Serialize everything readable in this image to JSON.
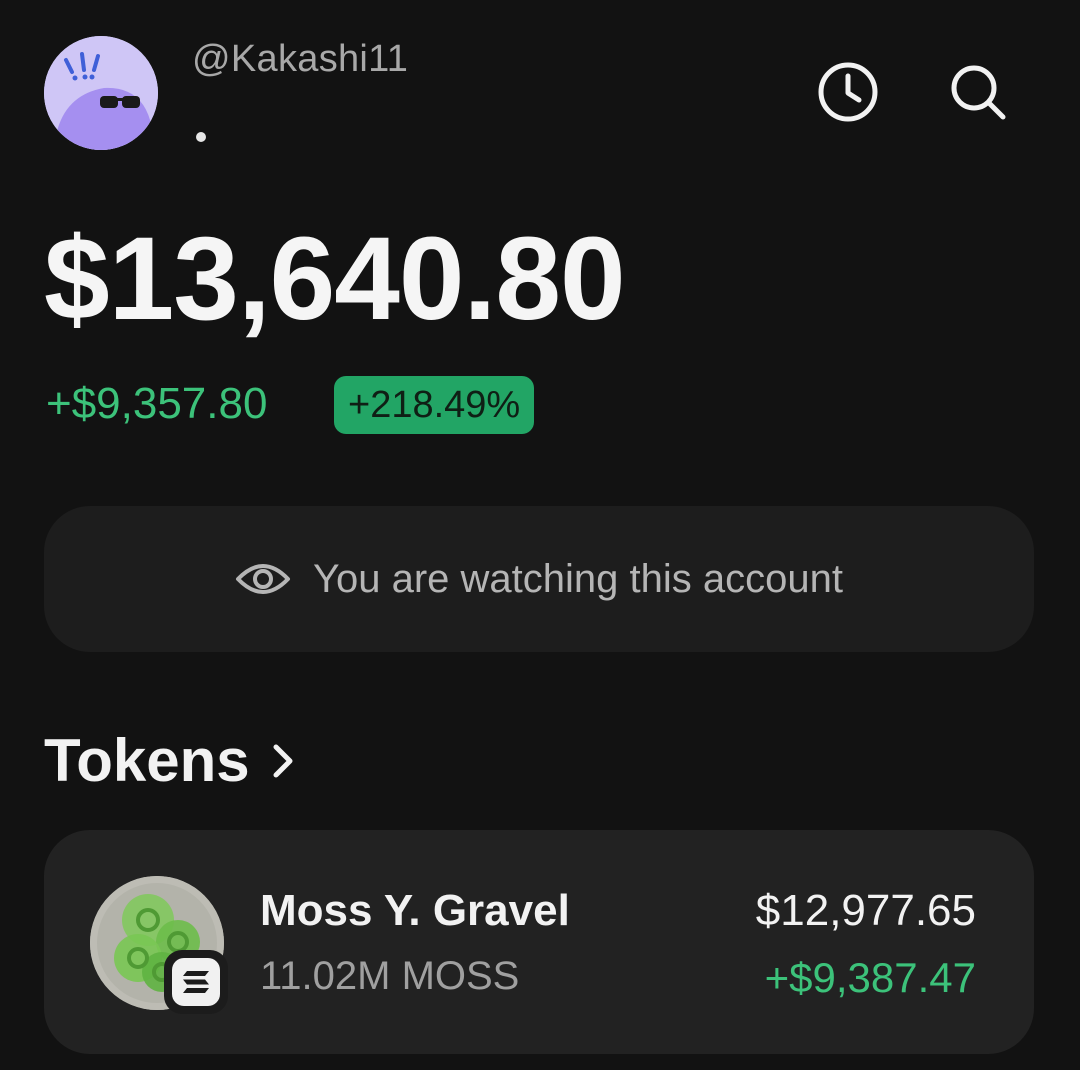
{
  "profile": {
    "handle": "@Kakashi11"
  },
  "header": {
    "history_icon": "clock-icon",
    "search_icon": "search-icon"
  },
  "balance": {
    "total": "$13,640.80",
    "change_amount": "+$9,357.80",
    "change_percent": "+218.49%"
  },
  "watch_banner": {
    "icon": "eye-icon",
    "text": "You are watching this account"
  },
  "tokens": {
    "title": "Tokens",
    "items": [
      {
        "name": "Moss Y. Gravel",
        "amount": "11.02M MOSS",
        "value": "$12,977.65",
        "change": "+$9,387.47",
        "chain_icon": "solana-icon"
      }
    ]
  },
  "colors": {
    "background": "#121212",
    "positive": "#3cc27a",
    "badge_bg": "#22a565",
    "card_bg": "#222222",
    "avatar_bg": "#cfc6f6"
  }
}
